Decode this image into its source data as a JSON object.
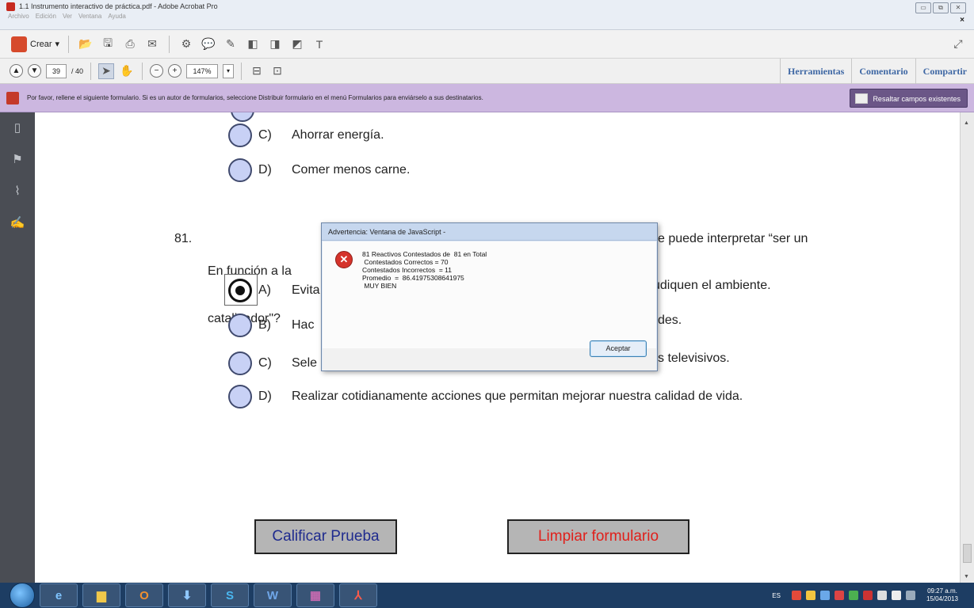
{
  "window": {
    "title": "1.1 Instrumento interactivo de práctica.pdf - Adobe Acrobat Pro",
    "menu": [
      "Archivo",
      "Edición",
      "Ver",
      "Ventana",
      "Ayuda"
    ]
  },
  "toolbar": {
    "create_label": "Crear",
    "page_current": "39",
    "page_total": "/ 40",
    "zoom": "147%"
  },
  "right_tabs": [
    "Herramientas",
    "Comentario",
    "Compartir"
  ],
  "notification": {
    "text": "Por favor, rellene el siguiente formulario. Si es un autor de formularios, seleccione Distribuir formulario en el menú Formularios para enviárselo a sus destinatarios.",
    "button": "Resaltar campos existentes"
  },
  "document": {
    "prev_options": [
      {
        "letter": "C)",
        "text": "Ahorrar energía."
      },
      {
        "letter": "D)",
        "text": "Comer menos carne."
      }
    ],
    "question": {
      "number": "81.",
      "text_a": "En función a la",
      "text_b": "catalizador\"?",
      "text_right": "se puede interpretar “ser un"
    },
    "options": [
      {
        "letter": "A)",
        "text": "Evita",
        "right": "udiquen el ambiente.",
        "selected": true
      },
      {
        "letter": "B)",
        "text": "Hac",
        "right": "des.",
        "selected": false
      },
      {
        "letter": "C)",
        "text": "Sele",
        "right": "s televisivos.",
        "selected": false
      },
      {
        "letter": "D)",
        "text": "Realizar cotidianamente acciones que permitan mejorar nuestra calidad de vida.",
        "right": "",
        "selected": false
      }
    ],
    "btn_grade": "Calificar Prueba",
    "btn_clear": "Limpiar formulario"
  },
  "dialog": {
    "title": "Advertencia: Ventana de JavaScript -",
    "lines": [
      "81 Reactivos Contestados de  81 en Total",
      " Contestados Correctos = 70",
      "Contestados Incorrectos  = 11",
      "Promedio  =  86.41975308641975",
      " MUY BIEN"
    ],
    "ok": "Aceptar"
  },
  "taskbar": {
    "lang": "ES",
    "time": "09:27 a.m.",
    "date": "15/04/2013"
  },
  "colors": {
    "notif_bg": "#ccb7e0",
    "radio_fill": "#c8d1f5",
    "clear_text": "#e0201b",
    "grade_text": "#1f2b8e",
    "tab_text": "#3e67a4"
  }
}
